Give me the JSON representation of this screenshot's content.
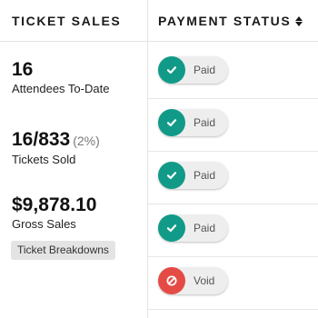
{
  "headers": {
    "ticket_sales": "TICKET SALES",
    "payment_status": "PAYMENT STATUS"
  },
  "stats": {
    "attendees": {
      "value": "16",
      "label": "Attendees To-Date"
    },
    "tickets": {
      "value": "16/833",
      "pct": "(2%)",
      "label": "Tickets Sold"
    },
    "gross": {
      "value": "$9,878.10",
      "label": "Gross Sales"
    }
  },
  "ticket_breakdowns_label": "Ticket Breakdowns",
  "payments": [
    {
      "status": "Paid",
      "icon": "check-icon",
      "color": "#119a88"
    },
    {
      "status": "Paid",
      "icon": "check-icon",
      "color": "#119a88"
    },
    {
      "status": "Paid",
      "icon": "check-icon",
      "color": "#119a88"
    },
    {
      "status": "Paid",
      "icon": "check-icon",
      "color": "#119a88"
    },
    {
      "status": "Void",
      "icon": "void-icon",
      "color": "#e54b45"
    }
  ]
}
